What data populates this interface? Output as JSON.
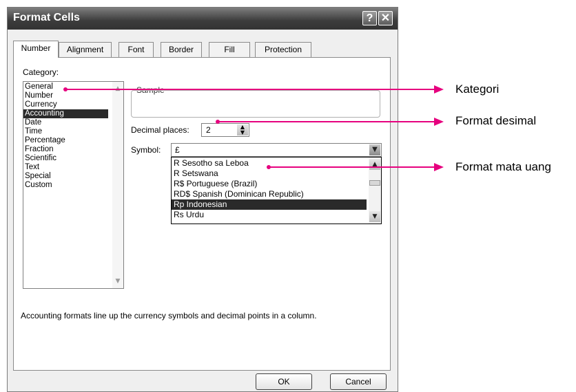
{
  "window": {
    "title": "Format Cells",
    "help_label": "?",
    "close_label": "✕"
  },
  "tabs": [
    "Number",
    "Alignment",
    "Font",
    "Border",
    "Fill",
    "Protection"
  ],
  "category": {
    "label": "Category:",
    "items": [
      "General",
      "Number",
      "Currency",
      "Accounting",
      "Date",
      "Time",
      "Percentage",
      "Fraction",
      "Scientific",
      "Text",
      "Special",
      "Custom"
    ],
    "selected": "Accounting"
  },
  "sample": {
    "label": "Sample",
    "value": ""
  },
  "decimal": {
    "label": "Decimal places:",
    "value": "2"
  },
  "symbol": {
    "label": "Symbol:",
    "value": "£",
    "options": [
      "R Sesotho sa Leboa",
      "R Setswana",
      "R$  Portuguese (Brazil)",
      "RD$ Spanish (Dominican Republic)",
      "Rp Indonesian",
      "Rs Urdu"
    ],
    "selected": "Rp Indonesian"
  },
  "description": "Accounting formats line up the currency symbols and decimal points in a column.",
  "buttons": {
    "ok": "OK",
    "cancel": "Cancel"
  },
  "annotations": {
    "kategori": "Kategori",
    "desimal": "Format desimal",
    "mata_uang": "Format mata uang"
  },
  "colors": {
    "annotation": "#e6007e",
    "selection": "#2a2a2a"
  }
}
